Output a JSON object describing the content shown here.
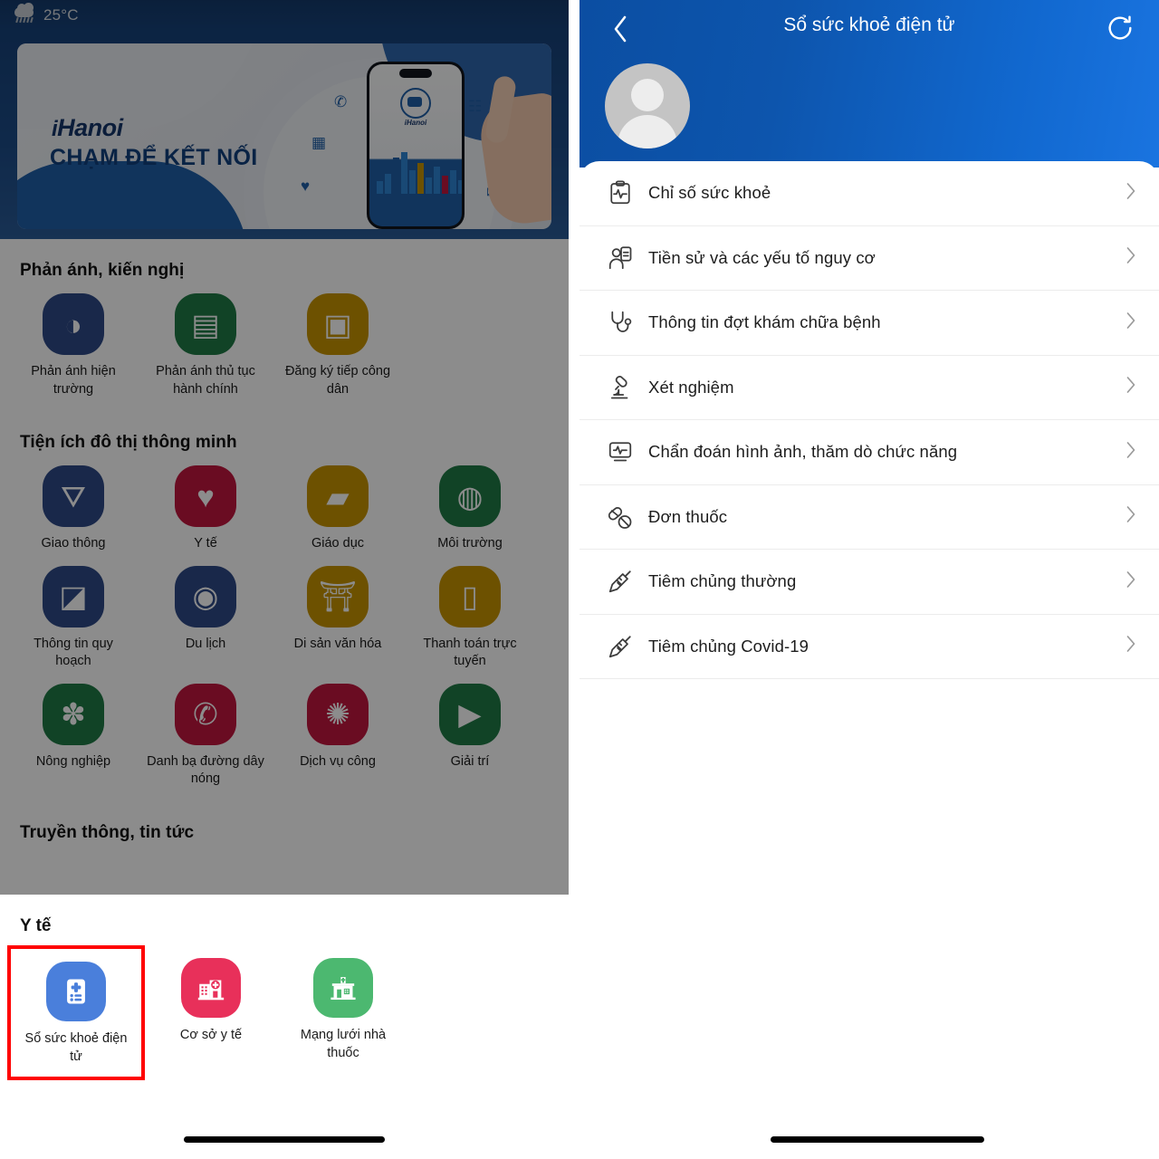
{
  "left_phone": {
    "status_bar": {
      "weather_icon": "rain-cloud-icon",
      "temperature": "25°C"
    },
    "banner": {
      "logo": "Hanoi",
      "logo_prefix": "i",
      "tagline": "CHẠM ĐỂ KẾT NỐI",
      "phone_app_name": "iHanoi",
      "floating_icons": [
        "phone-chat-icon",
        "traffic-light-icon",
        "heart-plus-icon",
        "people-chat-icon",
        "graduation-cap-icon",
        "mail-doc-icon"
      ]
    },
    "sections": [
      {
        "title": "Phản ánh, kiến nghị",
        "items": [
          {
            "label": "Phản ánh hiện trường",
            "color": "#2e4a87",
            "icon": "megaphone-chart-icon",
            "glyph": "◑"
          },
          {
            "label": "Phản ánh thủ tục hành chính",
            "color": "#1f7a45",
            "icon": "documents-icon",
            "glyph": "▤"
          },
          {
            "label": "Đăng ký tiếp công dân",
            "color": "#c79400",
            "icon": "id-card-edit-icon",
            "glyph": "▣"
          }
        ]
      },
      {
        "title": "Tiện ích đô thị thông minh",
        "items": [
          {
            "label": "Giao thông",
            "color": "#2e4a87",
            "icon": "traffic-light-icon",
            "glyph": "△"
          },
          {
            "label": "Y tế",
            "color": "#c1163f",
            "icon": "heart-plus-icon",
            "glyph": "♥"
          },
          {
            "label": "Giáo dục",
            "color": "#c79400",
            "icon": "graduation-cap-icon",
            "glyph": "▰"
          },
          {
            "label": "Môi trường",
            "color": "#1f7a45",
            "icon": "earth-trees-icon",
            "glyph": "◍"
          },
          {
            "label": "Thông tin quy hoạch",
            "color": "#2e4a87",
            "icon": "map-pin-icon",
            "glyph": "◩"
          },
          {
            "label": "Du lịch",
            "color": "#2e4a87",
            "icon": "globe-travel-icon",
            "glyph": "◉"
          },
          {
            "label": "Di sản văn hóa",
            "color": "#c79400",
            "icon": "temple-icon",
            "glyph": "⛩"
          },
          {
            "label": "Thanh toán trực tuyến",
            "color": "#c79400",
            "icon": "wallet-phone-icon",
            "glyph": "▯"
          },
          {
            "label": "Nông nghiệp",
            "color": "#1f7a45",
            "icon": "agriculture-icon",
            "glyph": "✽"
          },
          {
            "label": "Danh bạ đường dây nóng",
            "color": "#c1163f",
            "icon": "hotline-phone-icon",
            "glyph": "✆"
          },
          {
            "label": "Dịch vụ công",
            "color": "#c1163f",
            "icon": "public-service-icon",
            "glyph": "✺"
          },
          {
            "label": "Giải trí",
            "color": "#1f7a45",
            "icon": "play-circle-icon",
            "glyph": "▶"
          }
        ]
      },
      {
        "title": "Truyền thông, tin tức",
        "items": []
      }
    ],
    "bottom_sheet": {
      "title": "Y tế",
      "selected_index": 0,
      "highlight_color": "#ff0000",
      "items": [
        {
          "label": "Sổ sức khoẻ điện tử",
          "color": "#4a7fdb",
          "icon": "health-record-icon"
        },
        {
          "label": "Cơ sở y tế",
          "color": "#e8305a",
          "icon": "hospital-icon"
        },
        {
          "label": "Mạng lưới nhà thuốc",
          "color": "#4cb870",
          "icon": "pharmacy-icon"
        }
      ]
    }
  },
  "right_phone": {
    "header": {
      "title": "Sổ sức khoẻ điện tử",
      "back_icon": "chevron-left-icon",
      "refresh_icon": "refresh-icon",
      "avatar": "default-user-avatar",
      "gradient_from": "#0b4ea2",
      "gradient_to": "#1a74e0"
    },
    "menu_items": [
      {
        "label": "Chỉ số sức khoẻ",
        "icon": "clipboard-pulse-icon"
      },
      {
        "label": "Tiền sử và các yếu tố nguy cơ",
        "icon": "person-record-icon"
      },
      {
        "label": "Thông tin đợt khám chữa bệnh",
        "icon": "stethoscope-icon"
      },
      {
        "label": "Xét nghiệm",
        "icon": "microscope-icon"
      },
      {
        "label": "Chẩn đoán hình ảnh, thăm dò chức năng",
        "icon": "monitor-pulse-icon"
      },
      {
        "label": "Đơn thuốc",
        "icon": "pills-icon"
      },
      {
        "label": "Tiêm chủng thường",
        "icon": "syringe-icon"
      },
      {
        "label": "Tiêm chủng Covid-19",
        "icon": "syringe-icon"
      }
    ],
    "chevron_icon": "chevron-right-icon"
  }
}
